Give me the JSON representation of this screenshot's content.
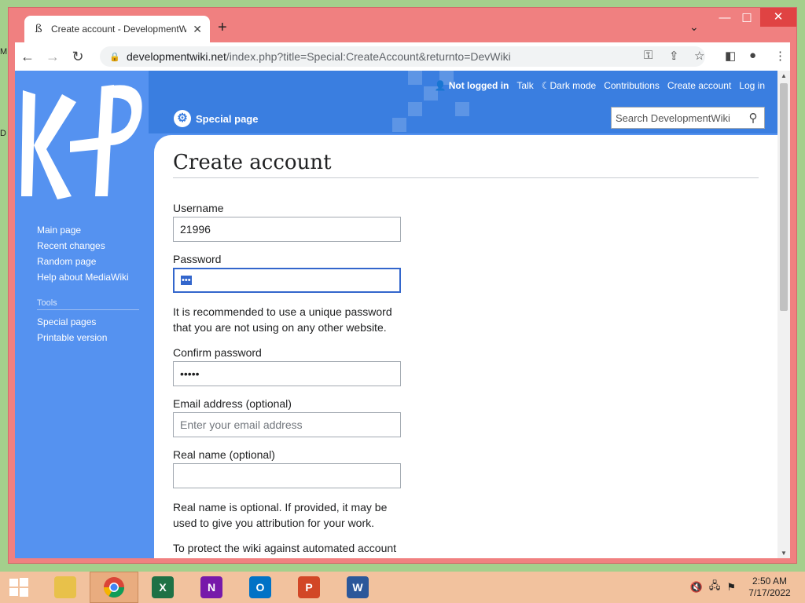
{
  "desktop": {
    "icon_label_1": "M",
    "icon_label_2": "D"
  },
  "browser": {
    "tab_title": "Create account - DevelopmentWiki",
    "tab_favicon": "ß",
    "url_host": "developmentwiki.net",
    "url_path": "/index.php?title=Special:CreateAccount&returnto=DevWiki"
  },
  "wiki": {
    "personal": {
      "status": "Not logged in",
      "talk": "Talk",
      "dark_mode": "Dark mode",
      "contributions": "Contributions",
      "create_account": "Create account",
      "log_in": "Log in"
    },
    "namespace_label": "Special page",
    "search_placeholder": "Search DevelopmentWiki",
    "sidebar": {
      "main_page": "Main page",
      "recent_changes": "Recent changes",
      "random_page": "Random page",
      "help": "Help about MediaWiki",
      "tools_heading": "Tools",
      "special_pages": "Special pages",
      "printable_version": "Printable version"
    },
    "page_title": "Create account",
    "form": {
      "username_label": "Username",
      "username_value": "21996",
      "password_label": "Password",
      "password_value": "•••",
      "password_help": "It is recommended to use a unique password that you are not using on any other website.",
      "confirm_label": "Confirm password",
      "confirm_value": "•••••",
      "email_label": "Email address (optional)",
      "email_placeholder": "Enter your email address",
      "realname_label": "Real name (optional)",
      "realname_help": "Real name is optional. If provided, it may be used to give you attribution for your work.",
      "captcha_intro": "To protect the wiki against automated account"
    }
  },
  "taskbar": {
    "time": "2:50 AM",
    "date": "7/17/2022",
    "apps": [
      "X",
      "N",
      "O",
      "P",
      "W"
    ]
  },
  "colors": {
    "wiki_blue": "#5592f0",
    "header_blue": "#3a7ee0",
    "window_frame": "#f08080",
    "taskbar": "#f2c29e"
  }
}
